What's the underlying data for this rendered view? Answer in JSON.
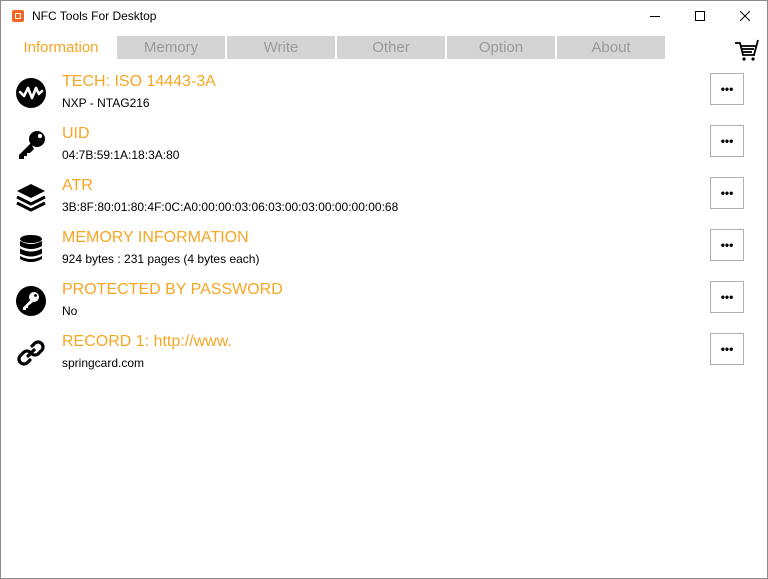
{
  "window": {
    "title": "NFC Tools For Desktop"
  },
  "tabs": [
    {
      "label": "Information",
      "active": true
    },
    {
      "label": "Memory",
      "active": false
    },
    {
      "label": "Write",
      "active": false
    },
    {
      "label": "Other",
      "active": false
    },
    {
      "label": "Option",
      "active": false
    },
    {
      "label": "About",
      "active": false
    }
  ],
  "toolbar": {
    "cart_icon": "cart-icon"
  },
  "rows": [
    {
      "icon": "wave-icon",
      "title": "TECH: ISO 14443-3A",
      "value": "NXP - NTAG216",
      "more_label": "•••"
    },
    {
      "icon": "key-icon",
      "title": "UID",
      "value": "04:7B:59:1A:18:3A:80",
      "more_label": "•••"
    },
    {
      "icon": "layers-icon",
      "title": "ATR",
      "value": "3B:8F:80:01:80:4F:0C:A0:00:00:03:06:03:00:03:00:00:00:00:68",
      "more_label": "•••"
    },
    {
      "icon": "database-icon",
      "title": "MEMORY INFORMATION",
      "value": "924 bytes : 231 pages (4 bytes each)",
      "more_label": "•••"
    },
    {
      "icon": "password-key-icon",
      "title": "PROTECTED BY PASSWORD",
      "value": "No",
      "more_label": "•••"
    },
    {
      "icon": "link-icon",
      "title": "RECORD 1: http://www.",
      "value": "springcard.com",
      "more_label": "•••"
    }
  ],
  "colors": {
    "accent": "#f5a623",
    "tab_inactive_bg": "#d4d4d4",
    "tab_inactive_text": "#9a9a9a"
  }
}
